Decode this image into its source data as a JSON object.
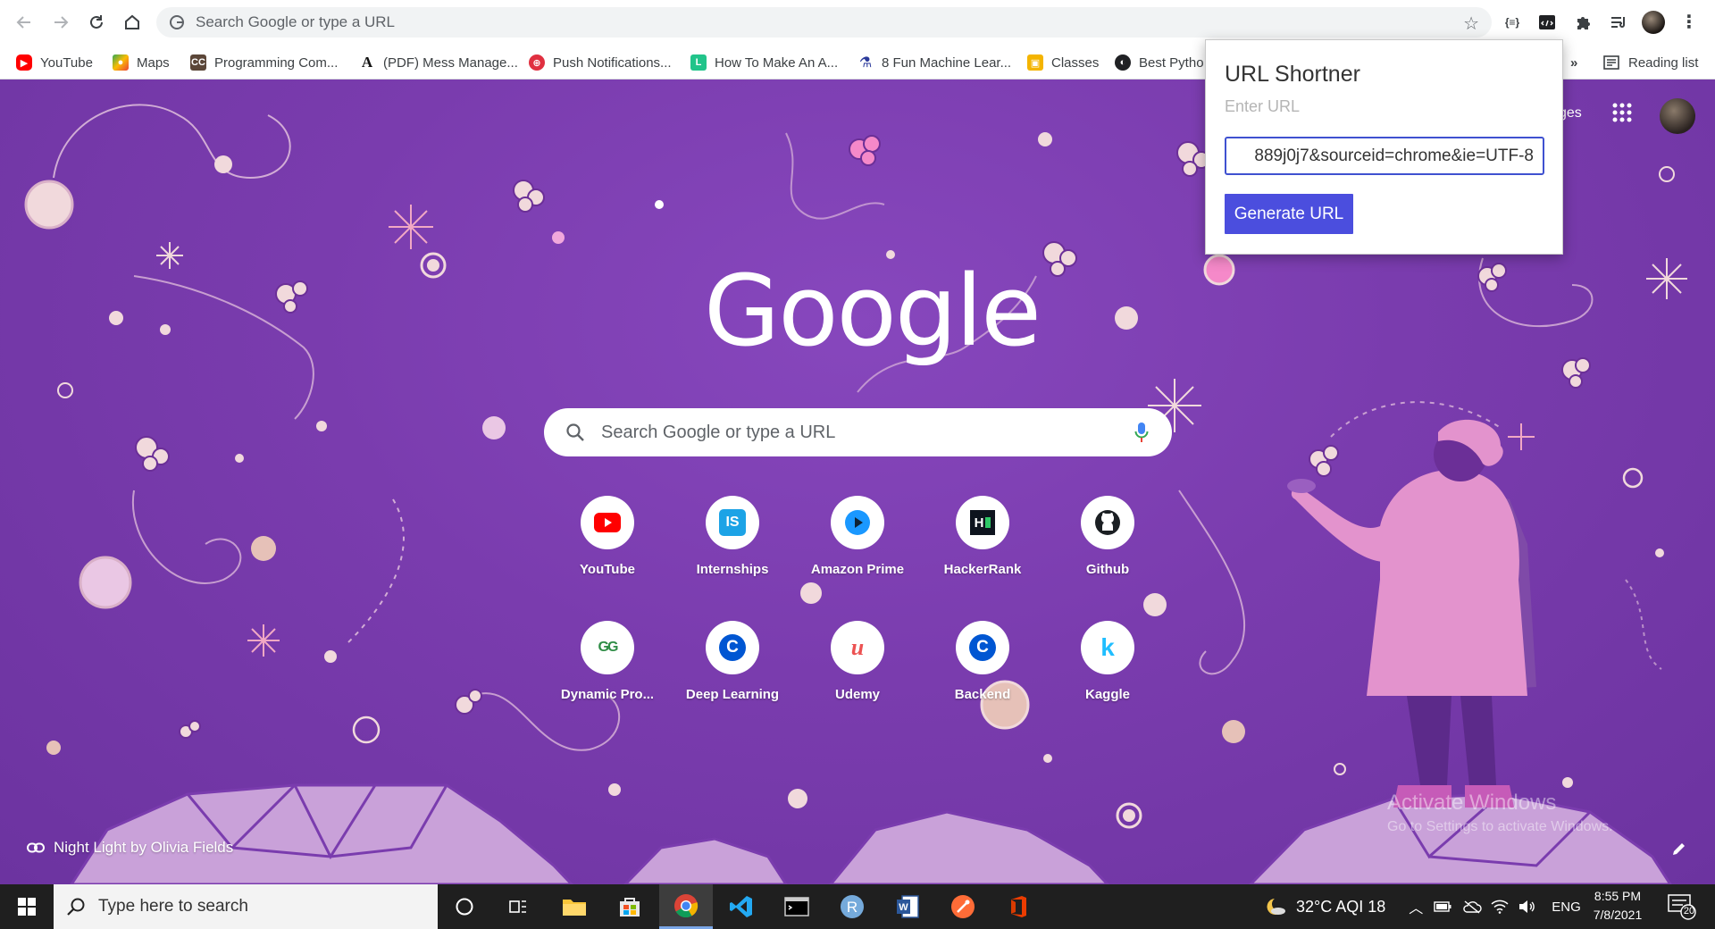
{
  "omnibox": {
    "placeholder": "Search Google or type a URL"
  },
  "bookmarks": [
    {
      "label": "YouTube",
      "icon": "youtube-icon"
    },
    {
      "label": "Maps",
      "icon": "maps-icon"
    },
    {
      "label": "Programming Com...",
      "icon": "codechef-icon"
    },
    {
      "label": "(PDF) Mess Manage...",
      "icon": "academia-icon"
    },
    {
      "label": "Push Notifications...",
      "icon": "push-icon"
    },
    {
      "label": "How To Make An A...",
      "icon": "l-icon"
    },
    {
      "label": "8 Fun Machine Lear...",
      "icon": "flask-icon"
    },
    {
      "label": "Classes",
      "icon": "classroom-icon"
    },
    {
      "label": "Best Pytho",
      "icon": "globe-icon"
    }
  ],
  "bookmarks_overflow": "»",
  "reading_list": "Reading list",
  "images_link": "ges",
  "ntp": {
    "logo": "Google",
    "search_placeholder": "Search Google or type a URL"
  },
  "shortcuts": [
    {
      "label": "YouTube",
      "icon": "youtube-icon"
    },
    {
      "label": "Internships",
      "icon": "internshala-icon",
      "glyph": "IS"
    },
    {
      "label": "Amazon Prime",
      "icon": "prime-video-icon"
    },
    {
      "label": "HackerRank",
      "icon": "hackerrank-icon",
      "glyph": "H"
    },
    {
      "label": "Github",
      "icon": "github-icon"
    },
    {
      "label": "Dynamic Pro...",
      "icon": "gfg-icon",
      "glyph": "GG"
    },
    {
      "label": "Deep Learning",
      "icon": "coursera-icon",
      "glyph": "C"
    },
    {
      "label": "Udemy",
      "icon": "udemy-icon",
      "glyph": "u"
    },
    {
      "label": "Backend",
      "icon": "coursera-icon",
      "glyph": "C"
    },
    {
      "label": "Kaggle",
      "icon": "kaggle-icon",
      "glyph": "k"
    }
  ],
  "attribution": "Night Light by Olivia Fields",
  "watermark": {
    "line1": "Activate Windows",
    "line2": "Go to Settings to activate Windows."
  },
  "popup": {
    "title": "URL Shortner",
    "subtitle": "Enter URL",
    "input_value": "889j0j7&sourceid=chrome&ie=UTF-8",
    "button": "Generate URL"
  },
  "taskbar": {
    "search_placeholder": "Type here to search",
    "weather": "32°C  AQI 18",
    "language": "ENG",
    "time": "8:55 PM",
    "date": "7/8/2021",
    "notifications": "20"
  },
  "colors": {
    "accent": "#4b4ede",
    "ntp_bg": "#7b3db0",
    "taskbar": "#1f1f1f"
  }
}
